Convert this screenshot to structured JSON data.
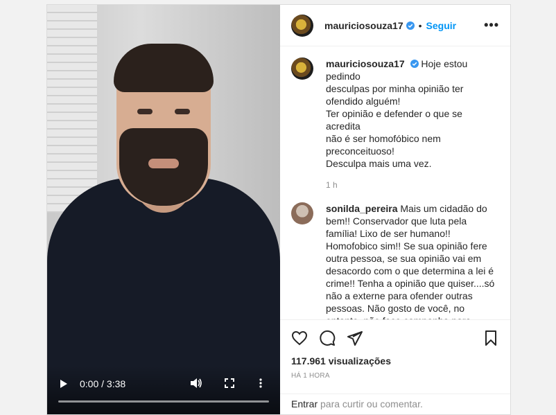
{
  "post": {
    "username": "mauriciosouza17",
    "follow_label": "Seguir",
    "separator": "•",
    "more_label": "•••"
  },
  "video": {
    "time": "0:00 / 3:38",
    "progress": 0
  },
  "caption": {
    "username": "mauriciosouza17",
    "text_lines": [
      "Hoje estou pedindo",
      "desculpas por minha opinião ter",
      "ofendido alguém!",
      "Ter opinião e defender o que se acredita",
      "não é ser homofóbico nem",
      "preconceituoso!",
      "Desculpa mais uma vez."
    ],
    "time": "1 h"
  },
  "comment": {
    "username": "sonilda_pereira",
    "text": "Mais um cidadão do bem!! Conservador que luta pela família! Lixo de ser humano!! Homofobico sim!! Se sua opinião fere outra pessoa, se sua opinião vai em desacordo com o que determina a lei é crime!! Tenha a opinião que quiser....só não a externe para ofender outras pessoas. Não gosto de você, no entanto, não faço campanha para lincha-lo. Redes sociais não é pra"
  },
  "stats": {
    "views": "117.961 visualizações",
    "ago": "HÁ 1 HORA"
  },
  "add_comment": {
    "enter_label": "Entrar",
    "rest": "para curtir ou comentar."
  },
  "icons": {
    "like": "heart-icon",
    "comment": "comment-icon",
    "share": "share-icon",
    "save": "bookmark-icon"
  }
}
